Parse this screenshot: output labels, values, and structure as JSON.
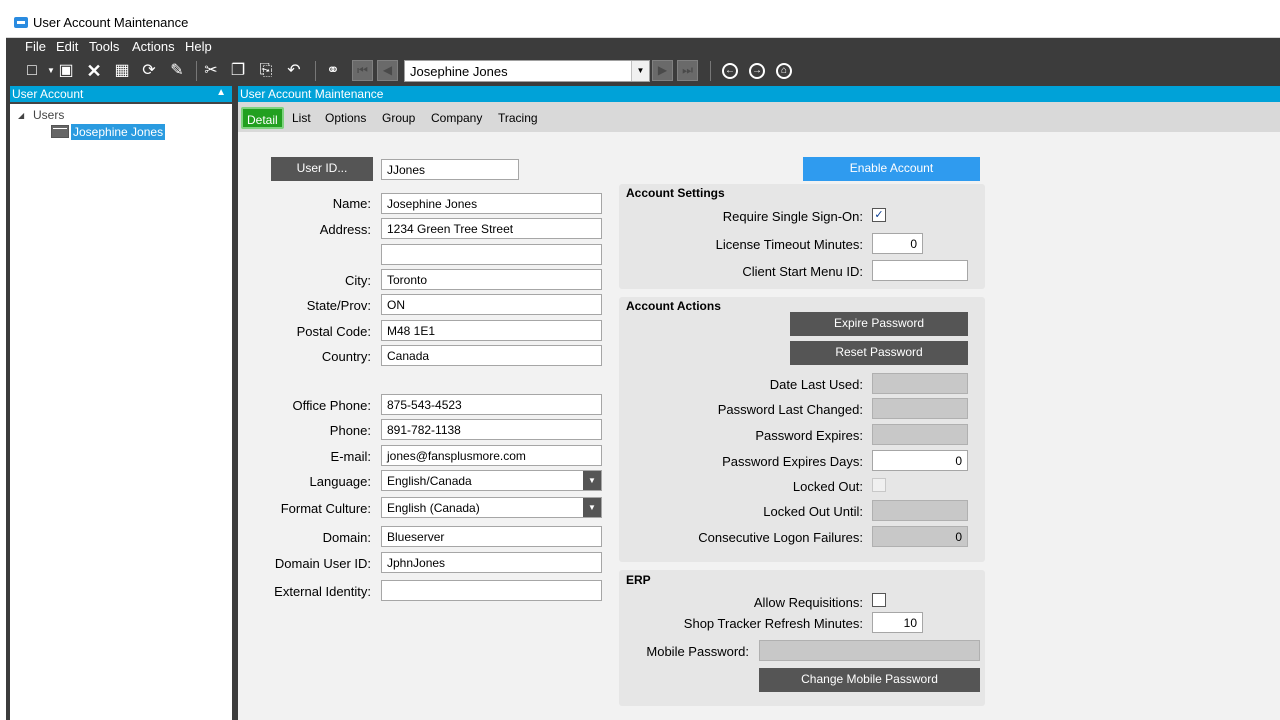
{
  "window": {
    "title": "User Account Maintenance"
  },
  "menu": [
    "File",
    "Edit",
    "Tools",
    "Actions",
    "Help"
  ],
  "toolbar": {
    "record_combo_value": "Josephine Jones",
    "icons": [
      "new-icon",
      "save-icon",
      "delete-icon",
      "clear-icon",
      "refresh-icon",
      "undo-changes-icon",
      "cut-icon",
      "copy-icon",
      "paste-icon",
      "undo-icon",
      "search-icon",
      "first-record-icon",
      "previous-record-icon",
      "next-record-icon",
      "last-record-icon",
      "back-icon",
      "forward-icon",
      "home-icon"
    ]
  },
  "left_panel": {
    "title": "User Account",
    "tree": {
      "root": "Users",
      "children": [
        "Josephine Jones"
      ]
    }
  },
  "main": {
    "title": "User Account Maintenance",
    "tabs": [
      "Detail",
      "List",
      "Options",
      "Group",
      "Company",
      "Tracing"
    ],
    "active_tab": "Detail"
  },
  "form": {
    "user_id_button": "User ID...",
    "user_id": "JJones",
    "name_label": "Name:",
    "name": "Josephine Jones",
    "address_label": "Address:",
    "address1": "1234 Green Tree Street",
    "address2": "",
    "city_label": "City:",
    "city": "Toronto",
    "state_label": "State/Prov:",
    "state": "ON",
    "postal_label": "Postal Code:",
    "postal": "M48 1E1",
    "country_label": "Country:",
    "country": "Canada",
    "office_phone_label": "Office Phone:",
    "office_phone": "875-543-4523",
    "phone_label": "Phone:",
    "phone": "891-782-1138",
    "email_label": "E-mail:",
    "email": "jones@fansplusmore.com",
    "language_label": "Language:",
    "language": "English/Canada",
    "format_culture_label": "Format Culture:",
    "format_culture": "English (Canada)",
    "domain_label": "Domain:",
    "domain": "Blueserver",
    "domain_user_id_label": "Domain User ID:",
    "domain_user_id": "JphnJones",
    "external_identity_label": "External Identity:",
    "external_identity": ""
  },
  "enable_account_button": "Enable Account",
  "account_settings": {
    "title": "Account Settings",
    "sso_label": "Require Single Sign-On:",
    "sso_checked": true,
    "license_timeout_label": "License Timeout Minutes:",
    "license_timeout": "0",
    "client_start_menu_label": "Client Start Menu ID:",
    "client_start_menu": ""
  },
  "account_actions": {
    "title": "Account Actions",
    "expire_password_button": "Expire Password",
    "reset_password_button": "Reset Password",
    "date_last_used_label": "Date Last Used:",
    "password_last_changed_label": "Password Last Changed:",
    "password_expires_label": "Password Expires:",
    "password_expires_days_label": "Password Expires Days:",
    "password_expires_days": "0",
    "locked_out_label": "Locked Out:",
    "locked_out": false,
    "locked_out_until_label": "Locked Out Until:",
    "consecutive_failures_label": "Consecutive Logon Failures:",
    "consecutive_failures": "0"
  },
  "erp": {
    "title": "ERP",
    "allow_requisitions_label": "Allow Requisitions:",
    "allow_requisitions": false,
    "shop_tracker_label": "Shop Tracker Refresh Minutes:",
    "shop_tracker": "10",
    "mobile_password_label": "Mobile Password:",
    "change_mobile_password_button": "Change Mobile Password"
  },
  "colors": {
    "accent": "#00a2d8",
    "active_tab": "#22a020",
    "primary_button": "#2f9bef",
    "dark_button": "#555555"
  }
}
